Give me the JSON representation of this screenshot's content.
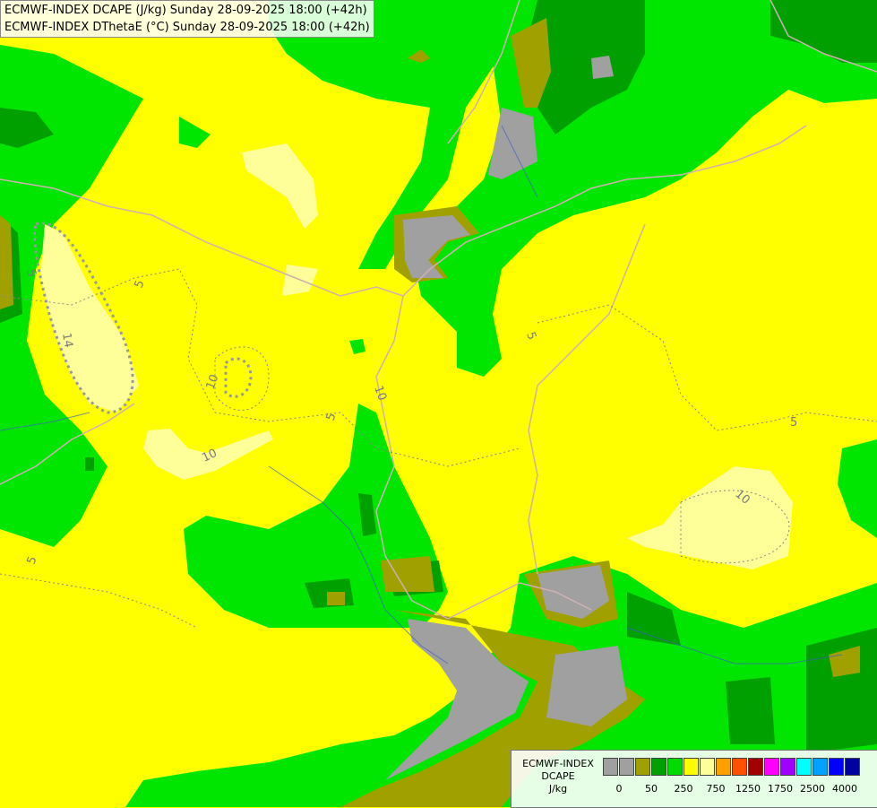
{
  "titles": {
    "line1": "ECMWF-INDEX DCAPE (J/kg) Sunday 28-09-2025 18:00 (+42h)",
    "line2": "ECMWF-INDEX DThetaE (°C) Sunday 28-09-2025 18:00 (+42h)"
  },
  "contour_labels": [
    "5",
    "14",
    "10",
    "5",
    "10",
    "5",
    "10",
    "5",
    "5",
    "10",
    "5"
  ],
  "legend": {
    "title_line1": "ECMWF-INDEX",
    "title_line2": "DCAPE",
    "unit": "J/kg",
    "colors": [
      "#a0a0a0",
      "#a0a0a0",
      "#a0a000",
      "#00a000",
      "#00dc00",
      "#ffff00",
      "#ffff99",
      "#ffa000",
      "#ff5000",
      "#a00000",
      "#ff00ff",
      "#a000ff",
      "#00ffff",
      "#00a0ff",
      "#0000ff",
      "#0000a0"
    ],
    "ticks": [
      "0",
      "50",
      "250",
      "750",
      "1250",
      "1750",
      "2500",
      "4000"
    ]
  }
}
